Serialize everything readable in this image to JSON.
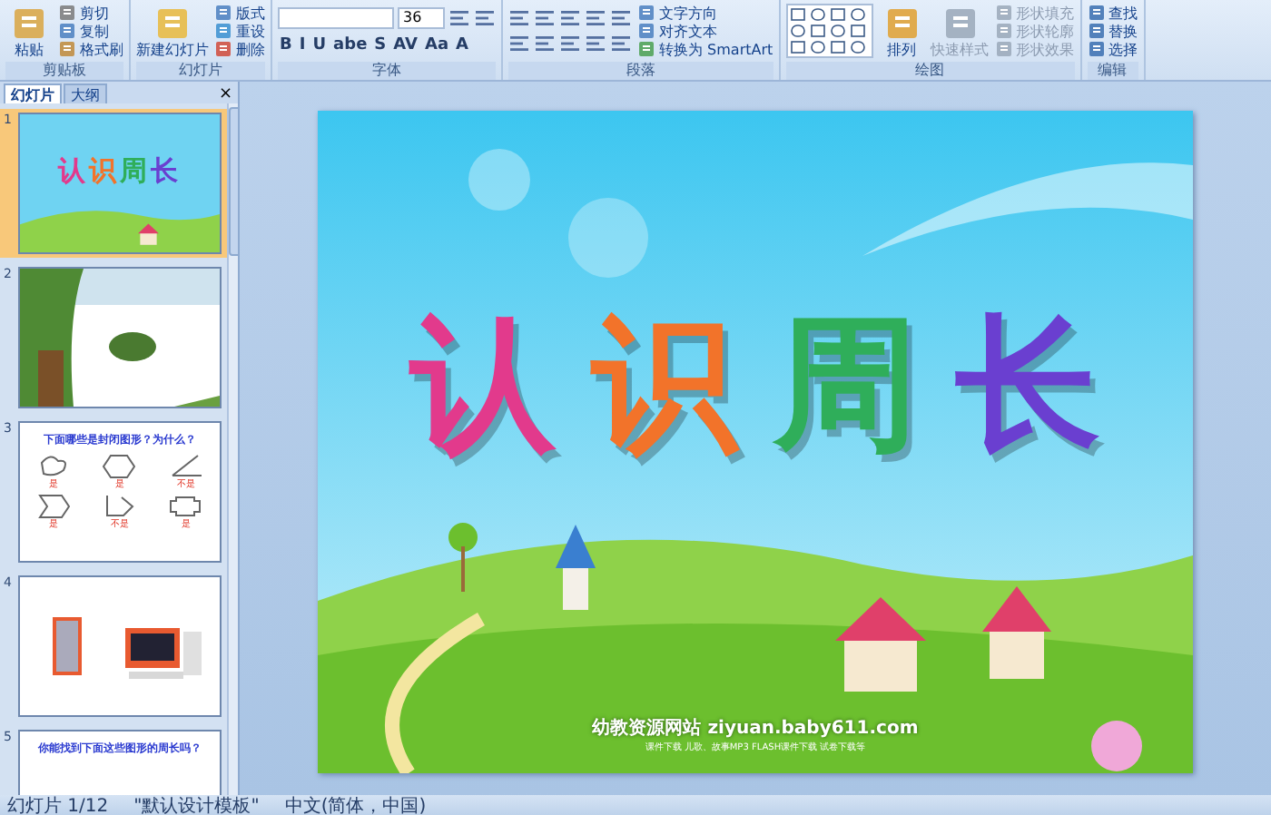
{
  "ribbon": {
    "groups": [
      {
        "label": "剪贴板",
        "large": [
          {
            "label": "粘贴",
            "disabled": false
          }
        ],
        "small": [
          {
            "label": "剪切",
            "disabled": false
          },
          {
            "label": "复制",
            "disabled": false
          },
          {
            "label": "格式刷",
            "disabled": false
          }
        ]
      },
      {
        "label": "幻灯片",
        "large": [
          {
            "label": "新建幻灯片",
            "disabled": false
          }
        ],
        "small": [
          {
            "label": "版式",
            "disabled": false
          },
          {
            "label": "重设",
            "disabled": false
          },
          {
            "label": "删除",
            "disabled": false
          }
        ]
      },
      {
        "label": "字体",
        "kind": "font",
        "size": "36",
        "tools": [
          "B",
          "I",
          "U",
          "abe",
          "S",
          "AV",
          "Aa",
          "A"
        ]
      },
      {
        "label": "段落",
        "kind": "paragraph",
        "small": [
          {
            "label": "文字方向",
            "disabled": false
          },
          {
            "label": "对齐文本",
            "disabled": false
          },
          {
            "label": "转换为 SmartArt",
            "disabled": false
          }
        ]
      },
      {
        "label": "绘图",
        "kind": "drawing",
        "large": [
          {
            "label": "排列",
            "disabled": false
          },
          {
            "label": "快速样式",
            "disabled": true
          }
        ],
        "small": [
          {
            "label": "形状填充",
            "disabled": true
          },
          {
            "label": "形状轮廓",
            "disabled": true
          },
          {
            "label": "形状效果",
            "disabled": true
          }
        ]
      },
      {
        "label": "编辑",
        "small": [
          {
            "label": "查找",
            "disabled": false
          },
          {
            "label": "替换",
            "disabled": false
          },
          {
            "label": "选择",
            "disabled": false
          }
        ]
      }
    ]
  },
  "panel": {
    "tabs": [
      {
        "label": "幻灯片",
        "selected": true
      },
      {
        "label": "大纲",
        "selected": false
      }
    ],
    "close": "×",
    "thumbnails": [
      {
        "number": "1",
        "selected": true,
        "kind": "title",
        "title": "认识周长"
      },
      {
        "number": "2",
        "selected": false,
        "kind": "picture"
      },
      {
        "number": "3",
        "selected": false,
        "kind": "shapes",
        "title": "下面哪些是封闭图形？为什么？",
        "answers": [
          "是",
          "是",
          "不是",
          "是",
          "不是",
          "是"
        ]
      },
      {
        "number": "4",
        "selected": false,
        "kind": "picture"
      },
      {
        "number": "5",
        "selected": false,
        "kind": "heading",
        "title": "你能找到下面这些图形的周长吗？"
      }
    ]
  },
  "slide": {
    "title_characters": [
      {
        "text": "认",
        "color": "#e23a8c"
      },
      {
        "text": "识",
        "color": "#f2732a"
      },
      {
        "text": "周",
        "color": "#2fae5a"
      },
      {
        "text": "长",
        "color": "#6a3fd0"
      }
    ],
    "site": "幼教资源网站  ziyuan.baby611.com",
    "tagline": "课件下载  儿歌、故事MP3  FLASH课件下载  试卷下载等"
  },
  "status_bar": [
    "幻灯片 1/12",
    "\"默认设计模板\"",
    "中文(简体，中国)"
  ]
}
